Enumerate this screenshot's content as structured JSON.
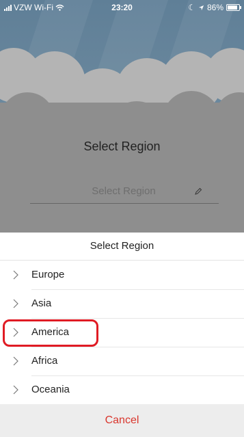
{
  "status_bar": {
    "carrier": "VZW Wi-Fi",
    "time": "23:20",
    "battery": "86%"
  },
  "screen": {
    "heading": "Select Region",
    "field_placeholder": "Select Region"
  },
  "sheet": {
    "title": "Select Region",
    "options": [
      "Europe",
      "Asia",
      "America",
      "Africa",
      "Oceania"
    ],
    "highlighted_option": "America",
    "cancel_label": "Cancel"
  },
  "colors": {
    "accent_red": "#d9362d",
    "highlight_border": "#e01b24"
  },
  "icons": [
    "signal-icon",
    "wifi-icon",
    "location-arrow-icon",
    "battery-icon",
    "pencil-icon",
    "chevron-right-icon"
  ]
}
